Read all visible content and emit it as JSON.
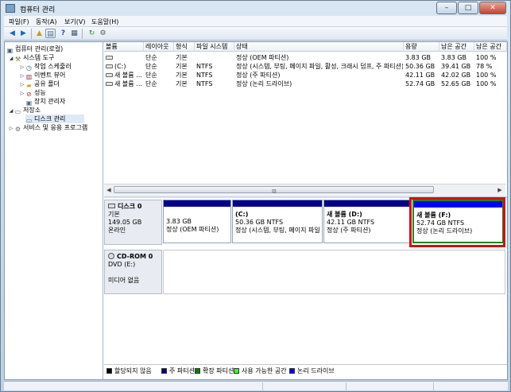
{
  "window": {
    "title": "컴퓨터 관리",
    "buttons": {
      "minimize": "–",
      "maximize": "□",
      "close": "✕"
    }
  },
  "menu": [
    "파일(F)",
    "동작(A)",
    "보기(V)",
    "도움말(H)"
  ],
  "toolbar": {
    "icons": [
      "back-icon",
      "forward-icon",
      "up-folder-icon",
      "show-tree-icon",
      "help-icon",
      "properties-icon",
      "refresh-icon",
      "settings-icon"
    ]
  },
  "tree": {
    "root": "컴퓨터 관리(로컬)",
    "system_tools": "시스템 도구",
    "task_scheduler": "작업 스케줄러",
    "event_viewer": "이벤트 뷰어",
    "shared_folders": "공유 폴더",
    "performance": "성능",
    "device_manager": "장치 관리자",
    "storage": "저장소",
    "disk_management": "디스크 관리",
    "services_apps": "서비스 및 응용 프로그램"
  },
  "volume_list": {
    "columns": [
      "볼륨",
      "레이아웃",
      "형식",
      "파일 시스템",
      "상태",
      "용량",
      "남은 공간",
      "남은 공간"
    ],
    "rows": [
      {
        "volume": "",
        "layout": "단순",
        "type": "기본",
        "fs": "",
        "status": "정상 (OEM 파티션)",
        "capacity": "3.83 GB",
        "free": "3.83 GB",
        "free_pct": "100 %"
      },
      {
        "volume": "(C:)",
        "layout": "단순",
        "type": "기본",
        "fs": "NTFS",
        "status": "정상 (시스템, 부팅, 페이지 파일, 활성, 크래시 덤프, 주 파티션)",
        "capacity": "50.36 GB",
        "free": "39.41 GB",
        "free_pct": "78 %"
      },
      {
        "volume": "새 볼륨 ...",
        "layout": "단순",
        "type": "기본",
        "fs": "NTFS",
        "status": "정상 (주 파티션)",
        "capacity": "42.11 GB",
        "free": "42.02 GB",
        "free_pct": "100 %"
      },
      {
        "volume": "새 볼륨 ...",
        "layout": "단순",
        "type": "기본",
        "fs": "NTFS",
        "status": "정상 (논리 드라이브)",
        "capacity": "52.74 GB",
        "free": "52.65 GB",
        "free_pct": "100 %"
      }
    ]
  },
  "disk0": {
    "name": "디스크 0",
    "type": "기본",
    "size": "149.05 GB",
    "state": "온라인",
    "partitions": [
      {
        "name": "",
        "size": "3.83 GB",
        "status": "정상 (OEM 파티션)",
        "bar_color": "#00008b"
      },
      {
        "name": "(C:)",
        "size": "50.36 GB NTFS",
        "status": "정상 (시스템, 부팅, 페이지 파일",
        "bar_color": "#00008b"
      },
      {
        "name": "새 볼륨 (D:)",
        "size": "42.11 GB NTFS",
        "status": "정상 (주 파티션)",
        "bar_color": "#00008b"
      },
      {
        "name": "새 볼륨 (F:)",
        "size": "52.74 GB NTFS",
        "status": "정상 (논리 드라이브)",
        "bar_color": "#0000ff"
      }
    ]
  },
  "cdrom0": {
    "name": "CD-ROM 0",
    "drive": "DVD (E:)",
    "state": "미디어 없음"
  },
  "legend": [
    {
      "label": "할당되지 않음",
      "color": "#000000"
    },
    {
      "label": "주 파티션",
      "color": "#00008b"
    },
    {
      "label": "확장 파티션",
      "color": "#008000"
    },
    {
      "label": "사용 가능한 공간",
      "color": "#33ff33"
    },
    {
      "label": "논리 드라이브",
      "color": "#0000ff"
    }
  ]
}
